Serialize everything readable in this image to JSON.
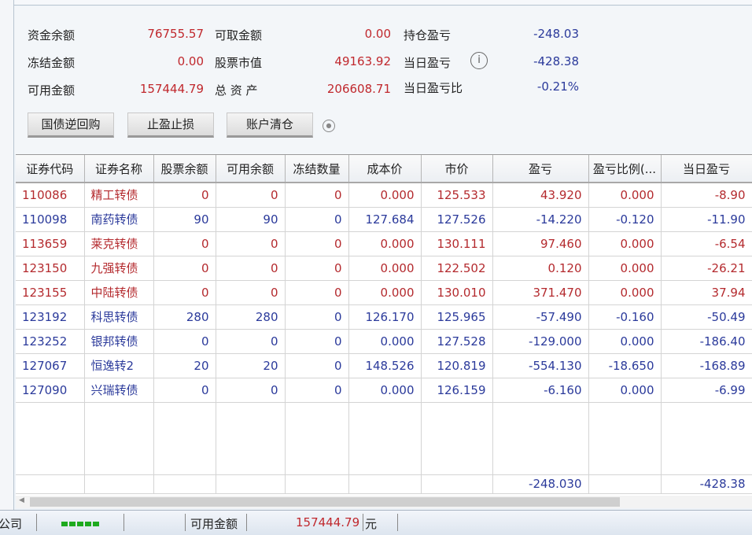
{
  "summary": {
    "fund_balance_label": "资金余额",
    "fund_balance": "76755.57",
    "withdrawable_label": "可取金额",
    "withdrawable": "0.00",
    "position_pl_label": "持仓盈亏",
    "position_pl": "-248.03",
    "frozen_label": "冻结金额",
    "frozen": "0.00",
    "stock_value_label": "股票市值",
    "stock_value": "49163.92",
    "daily_pl_label": "当日盈亏",
    "daily_pl": "-428.38",
    "available_label": "可用金额",
    "available": "157444.79",
    "total_assets_label": "总 资 产",
    "total_assets": "206608.71",
    "daily_pl_ratio_label": "当日盈亏比",
    "daily_pl_ratio": "-0.21%"
  },
  "buttons": {
    "repo": "国债逆回购",
    "stop": "止盈止损",
    "clear": "账户清仓"
  },
  "table": {
    "headers": [
      "证券代码",
      "证券名称",
      "股票余额",
      "可用余额",
      "冻结数量",
      "成本价",
      "市价",
      "盈亏",
      "盈亏比例(...",
      "当日盈亏"
    ],
    "rows": [
      [
        "110086",
        "精工转债",
        "0",
        "0",
        "0",
        "0.000",
        "125.533",
        "43.920",
        "0.000",
        "-8.90"
      ],
      [
        "110098",
        "南药转债",
        "90",
        "90",
        "0",
        "127.684",
        "127.526",
        "-14.220",
        "-0.120",
        "-11.90"
      ],
      [
        "113659",
        "莱克转债",
        "0",
        "0",
        "0",
        "0.000",
        "130.111",
        "97.460",
        "0.000",
        "-6.54"
      ],
      [
        "123150",
        "九强转债",
        "0",
        "0",
        "0",
        "0.000",
        "122.502",
        "0.120",
        "0.000",
        "-26.21"
      ],
      [
        "123155",
        "中陆转债",
        "0",
        "0",
        "0",
        "0.000",
        "130.010",
        "371.470",
        "0.000",
        "37.94"
      ],
      [
        "123192",
        "科思转债",
        "280",
        "280",
        "0",
        "126.170",
        "125.965",
        "-57.490",
        "-0.160",
        "-50.49"
      ],
      [
        "123252",
        "银邦转债",
        "0",
        "0",
        "0",
        "0.000",
        "127.528",
        "-129.000",
        "0.000",
        "-186.40"
      ],
      [
        "127067",
        "恒逸转2",
        "20",
        "20",
        "0",
        "148.526",
        "120.819",
        "-554.130",
        "-18.650",
        "-168.89"
      ],
      [
        "127090",
        "兴瑞转债",
        "0",
        "0",
        "0",
        "0.000",
        "126.159",
        "-6.160",
        "0.000",
        "-6.99"
      ]
    ],
    "total_pl": "-248.030",
    "total_daily_pl": "-428.38"
  },
  "status": {
    "company": "公司",
    "available_label": "可用金额",
    "available": "157444.79",
    "unit": "元"
  }
}
